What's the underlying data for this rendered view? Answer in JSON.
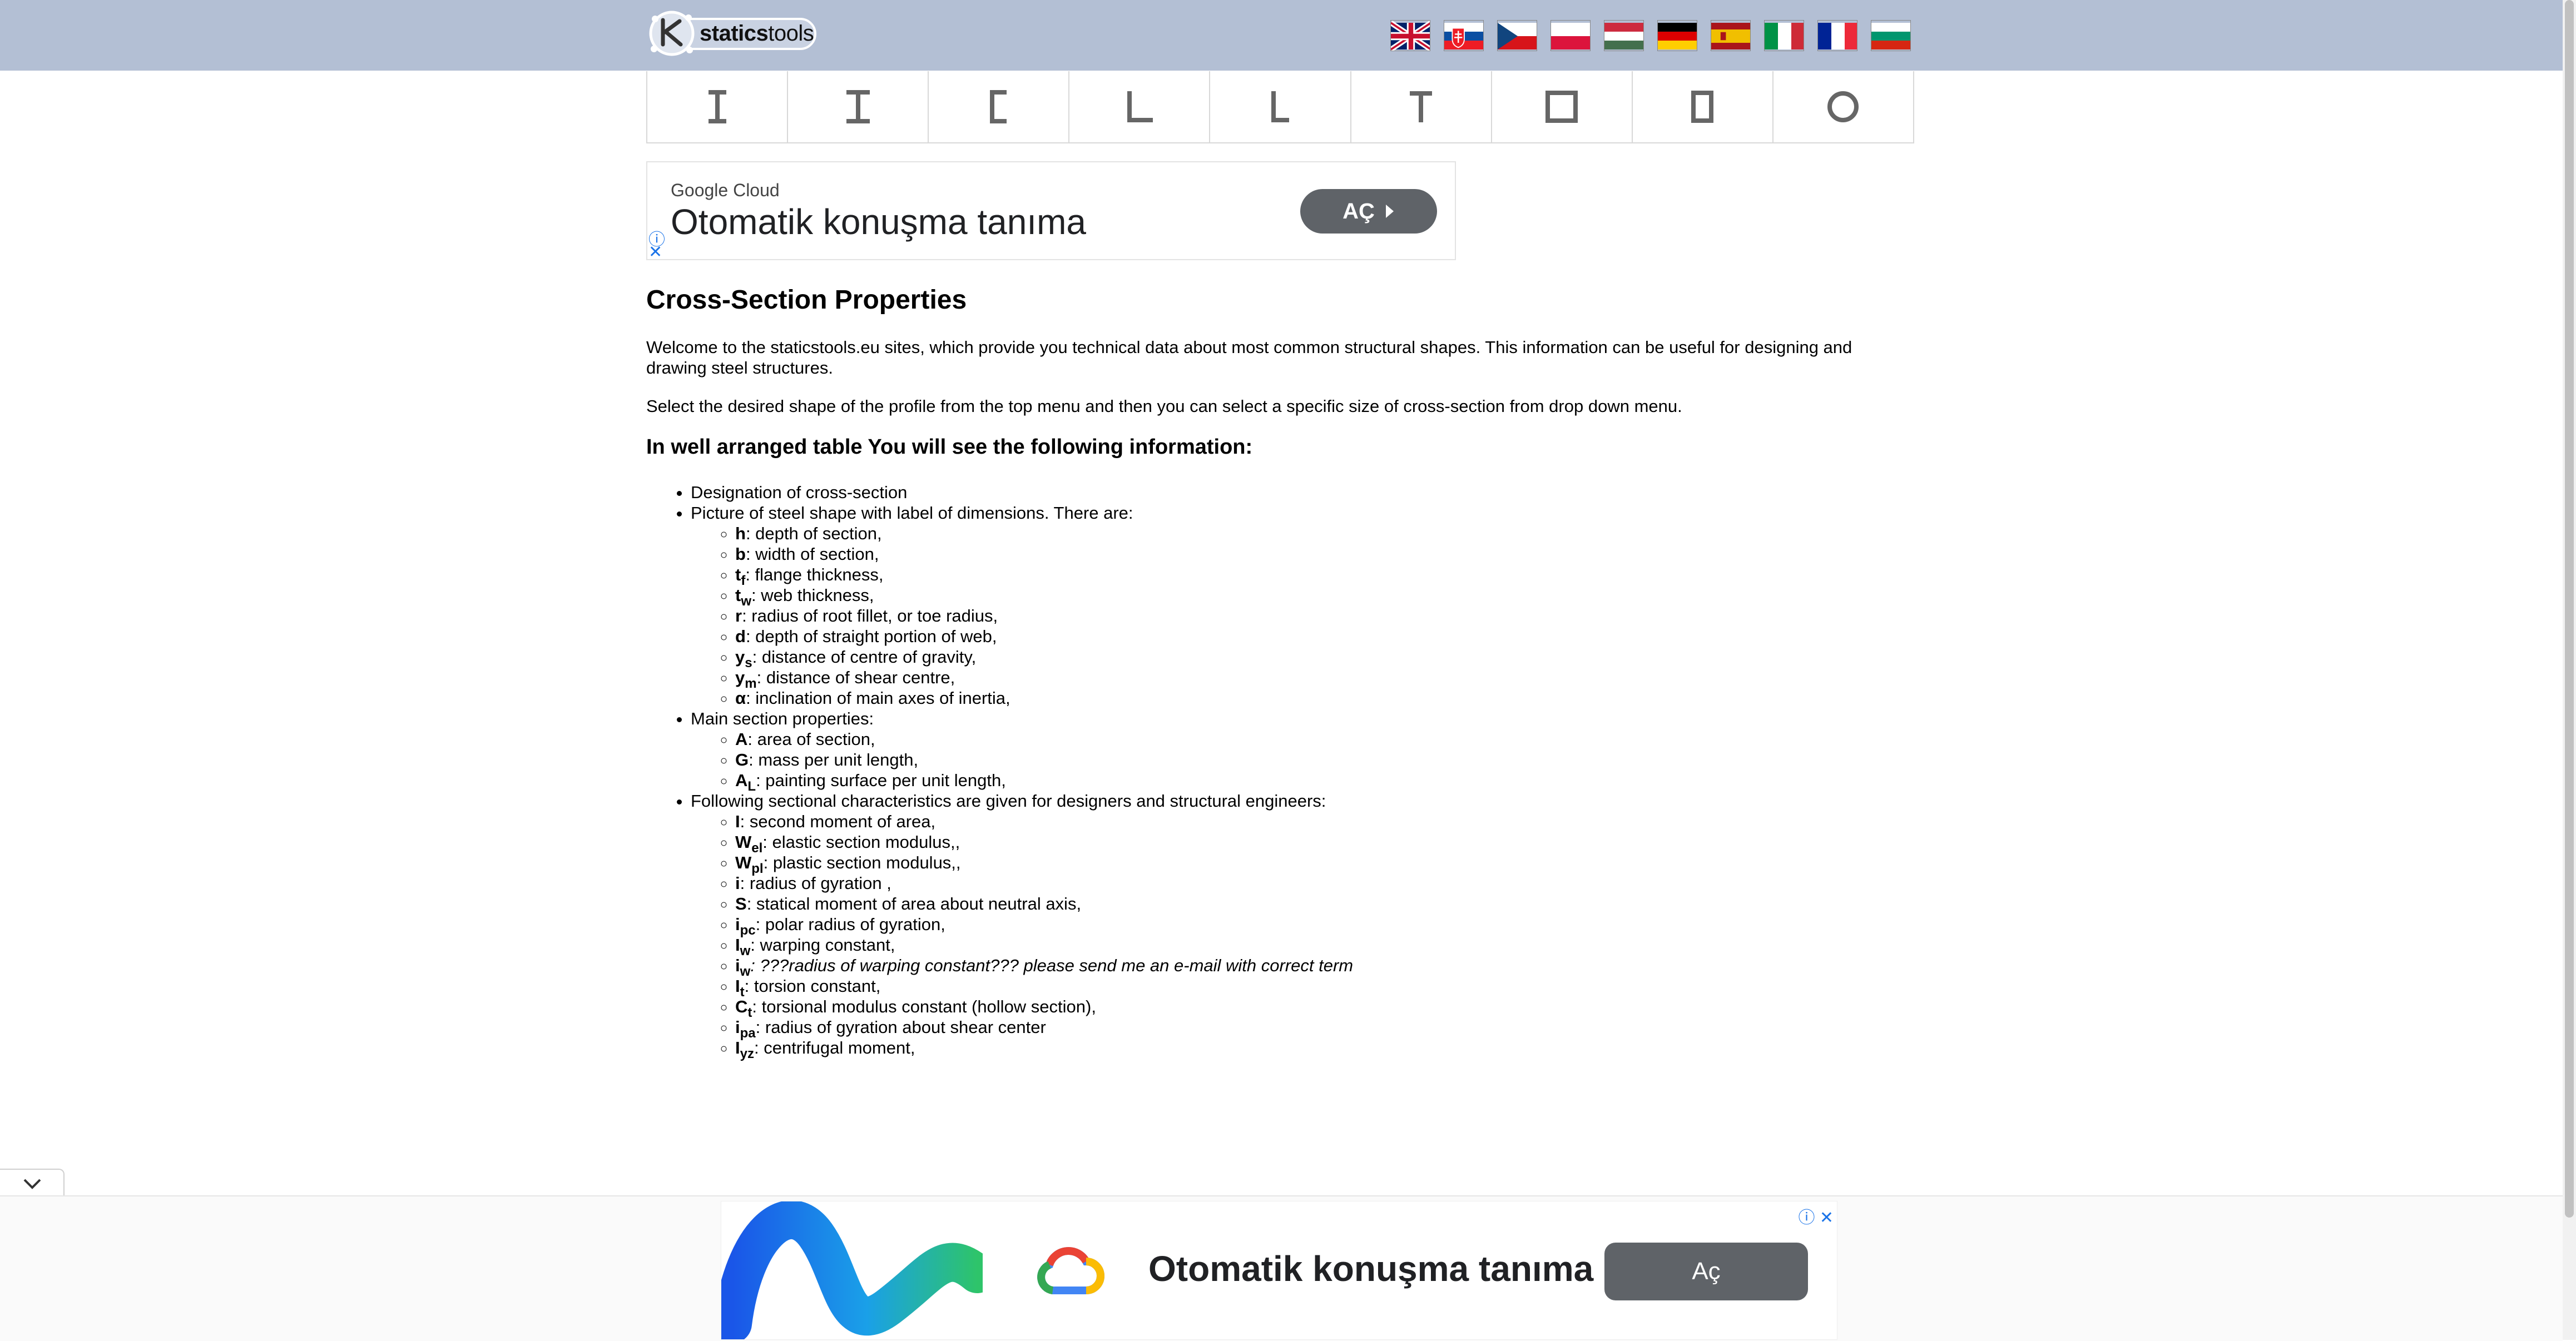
{
  "header": {
    "brand_bold": "statics",
    "brand_rest": "tools",
    "flags": [
      "english-flag",
      "slovak-flag",
      "czech-flag",
      "polish-flag",
      "hungarian-flag",
      "german-flag",
      "spanish-flag",
      "italian-flag",
      "french-flag",
      "bulgarian-flag"
    ]
  },
  "shape_menu": [
    {
      "name": "I-beam-narrow"
    },
    {
      "name": "I-beam-wide"
    },
    {
      "name": "channel"
    },
    {
      "name": "equal-angle"
    },
    {
      "name": "unequal-angle"
    },
    {
      "name": "tee"
    },
    {
      "name": "square-hollow"
    },
    {
      "name": "rectangular-hollow"
    },
    {
      "name": "circular-hollow"
    }
  ],
  "ad_top": {
    "provider": "Google Cloud",
    "headline": "Otomatik konuşma tanıma",
    "button": "AÇ"
  },
  "main": {
    "title": "Cross-Section Properties",
    "intro": "Welcome to the staticstools.eu sites, which provide you technical data about most common structural shapes. This information can be useful for designing and drawing steel structures.",
    "instruction": "Select the desired shape of the profile from the top menu and then you can select a specific size of cross-section from drop down menu.",
    "subtitle": "In well arranged table You will see the following information:",
    "item_designation": "Designation of cross-section",
    "item_picture": "Picture of steel shape with label of dimensions. There are:",
    "dims": [
      {
        "sym": "h",
        "sub": "",
        "desc": ": depth of section,"
      },
      {
        "sym": "b",
        "sub": "",
        "desc": ": width of section,"
      },
      {
        "sym": "t",
        "sub": "f",
        "desc": ": flange thickness,"
      },
      {
        "sym": "t",
        "sub": "w",
        "desc": ": web thickness,"
      },
      {
        "sym": "r",
        "sub": "",
        "desc": ": radius of root fillet, or toe radius,"
      },
      {
        "sym": "d",
        "sub": "",
        "desc": ": depth of straight portion of web,"
      },
      {
        "sym": "y",
        "sub": "s",
        "desc": ": distance of centre of gravity,"
      },
      {
        "sym": "y",
        "sub": "m",
        "desc": ": distance of shear centre,"
      },
      {
        "sym": "α",
        "sub": "",
        "desc": ": inclination of main axes of inertia,"
      }
    ],
    "item_main": "Main section properties:",
    "main_props": [
      {
        "sym": "A",
        "sub": "",
        "desc": ": area of section,"
      },
      {
        "sym": "G",
        "sub": "",
        "desc": ": mass per unit length,"
      },
      {
        "sym": "A",
        "sub": "L",
        "desc": ": painting surface per unit length,"
      }
    ],
    "item_following": "Following sectional characteristics are given for designers and structural engineers:",
    "chars": [
      {
        "sym": "I",
        "sub": "",
        "desc": ": second moment of area,"
      },
      {
        "sym": "W",
        "sub": "el",
        "desc": ": elastic section modulus,,"
      },
      {
        "sym": "W",
        "sub": "pl",
        "desc": ": plastic section modulus,,"
      },
      {
        "sym": "i",
        "sub": "",
        "desc": ": radius of gyration ,"
      },
      {
        "sym": "S",
        "sub": "",
        "desc": ": statical moment of area about neutral axis,"
      },
      {
        "sym": "i",
        "sub": "pc",
        "desc": ": polar radius of gyration,"
      },
      {
        "sym": "I",
        "sub": "w",
        "desc": ": warping constant,"
      },
      {
        "sym": "i",
        "sub": "w",
        "desc": ": ???radius of warping constant??? please send me an e-mail with correct term"
      },
      {
        "sym": "I",
        "sub": "t",
        "desc": ": torsion constant,"
      },
      {
        "sym": "C",
        "sub": "t",
        "desc": ": torsional modulus constant (hollow section),"
      },
      {
        "sym": "i",
        "sub": "pa",
        "desc": ": radius of gyration about shear center"
      },
      {
        "sym": "I",
        "sub": "yz",
        "desc": ": centrifugal moment,"
      }
    ]
  },
  "ad_bottom": {
    "headline": "Otomatik konuşma tanıma",
    "button": "Aç"
  }
}
